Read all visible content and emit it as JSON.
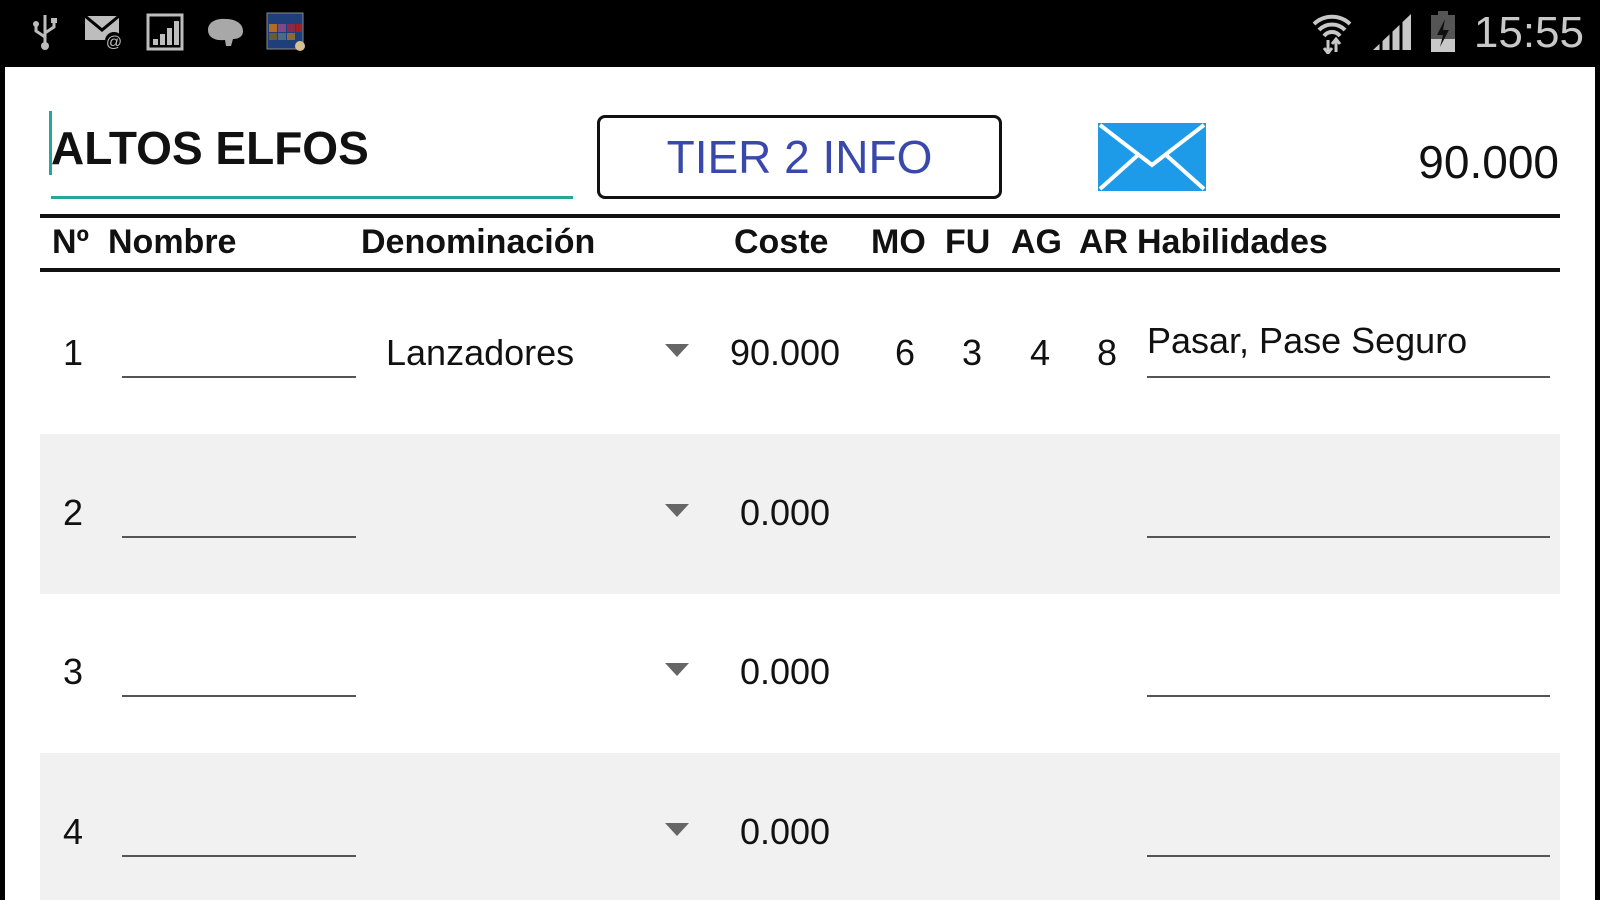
{
  "status_bar": {
    "time": "15:55",
    "left_icons": [
      "usb-icon",
      "email-icon",
      "signal-box-icon",
      "brain-icon",
      "wordhero-app-icon"
    ],
    "right_icons": [
      "wifi-icon",
      "cell-signal-icon",
      "battery-charging-icon"
    ]
  },
  "header": {
    "team_name": "ALTOS ELFOS",
    "tier_button": "TIER 2 INFO",
    "total": "90.000",
    "mail_color": "#1e9be8"
  },
  "columns": [
    "Nº",
    "Nombre",
    "Denominación",
    "Coste",
    "MO",
    "FU",
    "AG",
    "AR",
    "Habilidades"
  ],
  "rows": [
    {
      "num": "1",
      "nombre": "",
      "denominacion": "Lanzadores",
      "coste": "90.000",
      "mo": "6",
      "fu": "3",
      "ag": "4",
      "ar": "8",
      "habilidades": "Pasar, Pase Seguro"
    },
    {
      "num": "2",
      "nombre": "",
      "denominacion": "",
      "coste": "0.000",
      "mo": "",
      "fu": "",
      "ag": "",
      "ar": "",
      "habilidades": ""
    },
    {
      "num": "3",
      "nombre": "",
      "denominacion": "",
      "coste": "0.000",
      "mo": "",
      "fu": "",
      "ag": "",
      "ar": "",
      "habilidades": ""
    },
    {
      "num": "4",
      "nombre": "",
      "denominacion": "",
      "coste": "0.000",
      "mo": "",
      "fu": "",
      "ag": "",
      "ar": "",
      "habilidades": ""
    }
  ]
}
